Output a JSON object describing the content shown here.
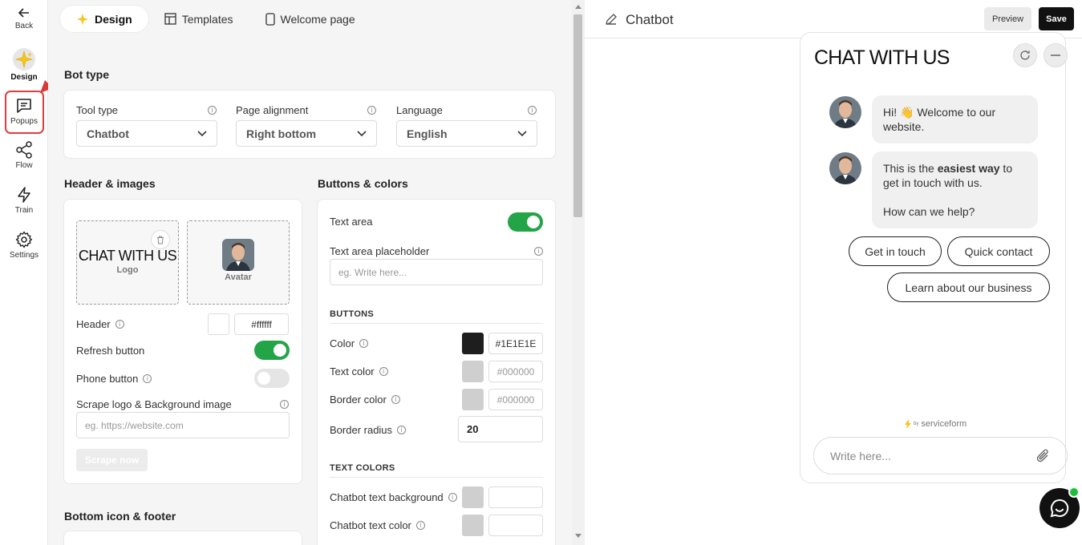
{
  "nav": {
    "back": "Back",
    "items": [
      {
        "label": "Design",
        "icon": "sparkle-icon"
      },
      {
        "label": "Popups",
        "icon": "chat-icon"
      },
      {
        "label": "Flow",
        "icon": "share-icon"
      },
      {
        "label": "Train",
        "icon": "bolt-icon"
      },
      {
        "label": "Settings",
        "icon": "gear-icon"
      }
    ]
  },
  "tabs": [
    "Design",
    "Templates",
    "Welcome page"
  ],
  "bot_type": {
    "title": "Bot type",
    "tool_type_label": "Tool type",
    "tool_type_value": "Chatbot",
    "alignment_label": "Page alignment",
    "alignment_value": "Right bottom",
    "language_label": "Language",
    "language_value": "English"
  },
  "header_images": {
    "title": "Header & images",
    "logo_text": "CHAT WITH US",
    "logo_caption": "Logo",
    "avatar_caption": "Avatar",
    "header_label": "Header",
    "header_color": "#ffffff",
    "refresh_label": "Refresh button",
    "phone_label": "Phone button",
    "scrape_label": "Scrape logo & Background image",
    "scrape_placeholder": "eg. https://website.com",
    "scrape_button": "Scrape now"
  },
  "buttons_colors": {
    "title": "Buttons & colors",
    "text_area_label": "Text area",
    "placeholder_label": "Text area placeholder",
    "placeholder_value": "eg. Write here...",
    "buttons_head": "BUTTONS",
    "color_label": "Color",
    "color_value": "#1E1E1E",
    "text_color_label": "Text color",
    "text_color_value": "#000000",
    "border_color_label": "Border color",
    "border_color_value": "#000000",
    "radius_label": "Border radius",
    "radius_value": "20",
    "text_colors_head": "TEXT COLORS",
    "chat_bg_label": "Chatbot text background",
    "chat_color_label": "Chatbot text color"
  },
  "bottom_title": "Bottom icon & footer",
  "preview": {
    "title": "Chatbot",
    "preview_btn": "Preview",
    "save_btn": "Save",
    "chat_title": "CHAT WITH US",
    "msg1_a": "Hi! ",
    "msg1_b": " Welcome to our website.",
    "msg2_a": "This is the ",
    "msg2_b": "easiest way",
    "msg2_c": " to get in touch with us.",
    "msg2_d": "How can we help?",
    "btn1": "Get in touch",
    "btn2": "Quick contact",
    "btn3": "Learn about our business",
    "powered_by": "by",
    "powered_brand": "serviceform",
    "input_placeholder": "Write here..."
  },
  "colors": {
    "accent_green": "#22a447",
    "dark": "#1E1E1E",
    "highlight": "#e23c3c"
  }
}
